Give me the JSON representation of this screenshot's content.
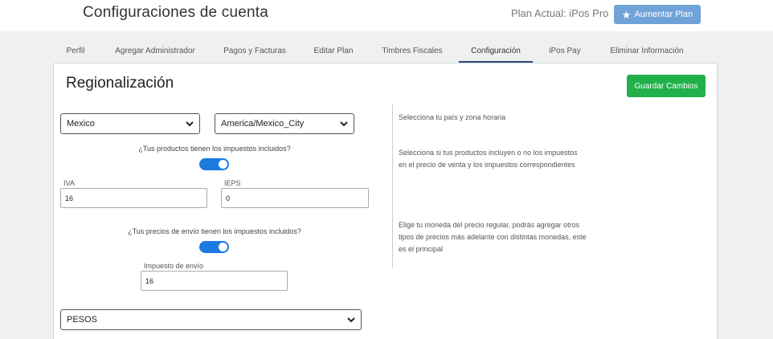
{
  "header": {
    "title": "Configuraciones de cuenta",
    "plan_label": "Plan Actual: iPos Pro",
    "upgrade_button": "Aumentar Plan",
    "upgrade_icon": "star-icon"
  },
  "tabs": [
    {
      "label": "Perfil",
      "active": false
    },
    {
      "label": "Agregar Administrador",
      "active": false
    },
    {
      "label": "Pagos y Facturas",
      "active": false
    },
    {
      "label": "Editar Plan",
      "active": false
    },
    {
      "label": "Timbres Fiscales",
      "active": false
    },
    {
      "label": "Configuración",
      "active": true
    },
    {
      "label": "iPos Pay",
      "active": false
    },
    {
      "label": "Eliminar Información",
      "active": false
    }
  ],
  "section": {
    "title": "Regionalización",
    "save_button": "Guardar Cambios"
  },
  "form": {
    "country": "Mexico",
    "timezone": "America/Mexico_City",
    "taxes_included_question": "¿Tus productos tienen los impuestos incluidos?",
    "taxes_included": true,
    "iva_label": "IVA",
    "iva_value": "16",
    "ieps_label": "IEPS",
    "ieps_value": "0",
    "shipping_question": "¿Tus precios de envío tienen los impuestos incluidos?",
    "shipping_included": true,
    "shipping_tax_label": "Impuesto de envío",
    "shipping_tax_value": "16",
    "currency": "PESOS"
  },
  "help": {
    "country_help": "Selecciona tu país y zona horaria",
    "taxes_help": "Selecciona si tus productos incluyen o no los impuestos en el precio de venta y los impuestos correspondientes",
    "currency_help": "Elige tu moneda del precio regular, podrás agregar otros tipos de precios más adelante con distintas monedas, este es el principal"
  },
  "colors": {
    "save_button": "#21b04a",
    "upgrade_button": "#6fa3d8",
    "toggle_on": "#1a7ae0",
    "active_tab_underline": "#2e4a7a"
  }
}
